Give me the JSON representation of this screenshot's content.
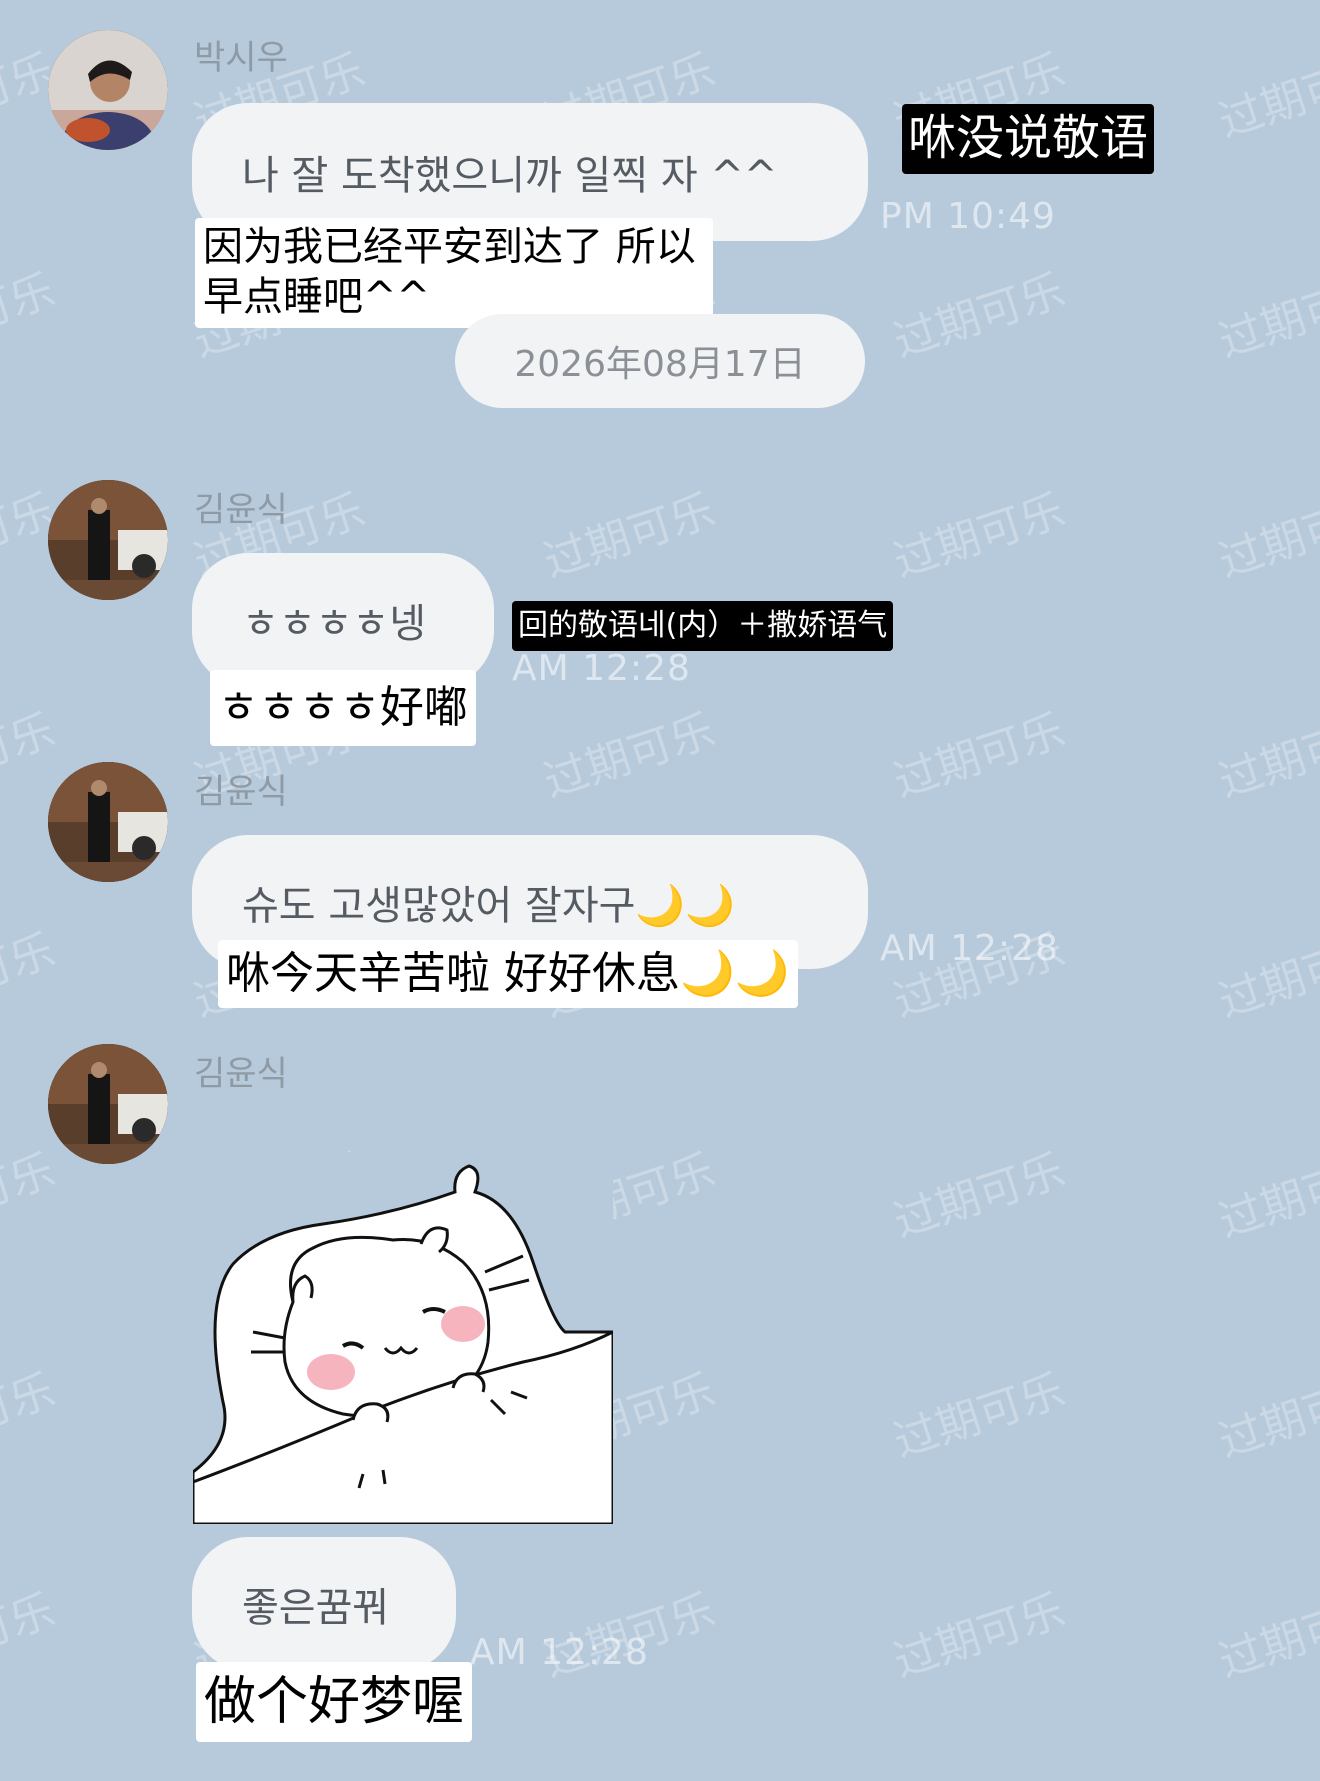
{
  "watermark_text": "过期可乐",
  "messages": [
    {
      "sender": "박시우",
      "text": "나 잘 도착했으니까 일찍 자 ^^",
      "time": "PM 10:49",
      "translation_lines": [
        "因为我已经平安到达了 所以",
        "早点睡吧^^"
      ],
      "note": "咻没说敬语"
    },
    {
      "sender": "김윤식",
      "text": "ㅎㅎㅎㅎ넹",
      "time": "AM 12:28",
      "translation": "ㅎㅎㅎㅎ好嘟",
      "note": "回的敬语네(内）＋撒娇语气"
    },
    {
      "sender": "김윤식",
      "text": "슈도 고생많았어 잘자구🌙🌙",
      "time": "AM 12:28",
      "translation": "咻今天辛苦啦 好好休息🌙🌙"
    },
    {
      "sender": "김윤식",
      "sticker": "sleeping-cat-sticker",
      "text": "좋은꿈꿔",
      "time": "AM 12:28",
      "translation": "做个好梦喔"
    }
  ],
  "date_separator": "2026年08月17日",
  "colors": {
    "background": "#b7cadb",
    "bubble": "#f2f3f5",
    "bubble_text": "#555b63",
    "time_text": "#e4eaf0"
  }
}
